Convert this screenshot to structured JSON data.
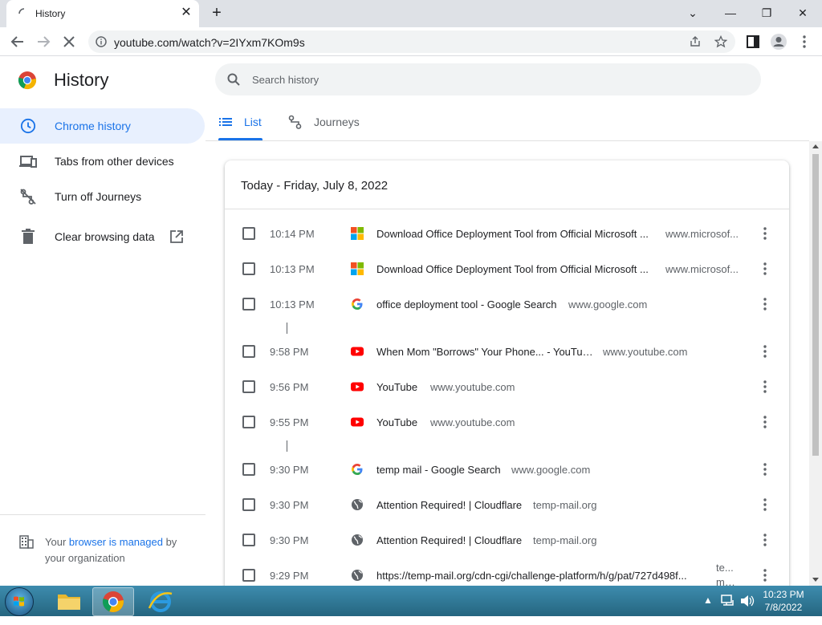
{
  "browser": {
    "tab_title": "History",
    "tab_close": "✕",
    "new_tab": "+",
    "url": "youtube.com/watch?v=2IYxm7KOm9s",
    "window_controls": [
      "⌄",
      "—",
      "❐",
      "✕"
    ]
  },
  "header": {
    "title": "History",
    "search_placeholder": "Search history"
  },
  "sidebar": {
    "items": [
      {
        "label": "Chrome history",
        "icon": "clock-icon",
        "active": true
      },
      {
        "label": "Tabs from other devices",
        "icon": "devices-icon",
        "active": false
      },
      {
        "label": "Turn off Journeys",
        "icon": "journeys-off-icon",
        "active": false
      },
      {
        "label": "Clear browsing data",
        "icon": "trash-icon",
        "active": false
      }
    ],
    "managed_prefix": "Your ",
    "managed_link": "browser is managed",
    "managed_suffix": " by your organization"
  },
  "tabs": [
    {
      "label": "List",
      "icon": "list-icon",
      "active": true
    },
    {
      "label": "Journeys",
      "icon": "journeys-icon",
      "active": false
    }
  ],
  "card": {
    "title": "Today - Friday, July 8, 2022"
  },
  "rows": [
    {
      "time": "10:14 PM",
      "favicon": "microsoft",
      "title": "Download Office Deployment Tool from Official Microsoft ...",
      "domain": "www.microsof..."
    },
    {
      "time": "10:13 PM",
      "favicon": "microsoft",
      "title": "Download Office Deployment Tool from Official Microsoft ...",
      "domain": "www.microsof..."
    },
    {
      "time": "10:13 PM",
      "favicon": "google",
      "title": "office deployment tool - Google Search",
      "domain": "www.google.com"
    },
    {
      "time": "9:58 PM",
      "favicon": "youtube",
      "title": "When Mom \"Borrows\" Your Phone... - YouTube",
      "domain": "www.youtube.com"
    },
    {
      "time": "9:56 PM",
      "favicon": "youtube",
      "title": "YouTube",
      "domain": "www.youtube.com"
    },
    {
      "time": "9:55 PM",
      "favicon": "youtube",
      "title": "YouTube",
      "domain": "www.youtube.com"
    },
    {
      "time": "9:30 PM",
      "favicon": "google",
      "title": "temp mail - Google Search",
      "domain": "www.google.com"
    },
    {
      "time": "9:30 PM",
      "favicon": "globe",
      "title": "Attention Required! | Cloudflare",
      "domain": "temp-mail.org"
    },
    {
      "time": "9:30 PM",
      "favicon": "globe",
      "title": "Attention Required! | Cloudflare",
      "domain": "temp-mail.org"
    },
    {
      "time": "9:29 PM",
      "favicon": "globe",
      "title": "https://temp-mail.org/cdn-cgi/challenge-platform/h/g/pat/727d498f...",
      "domain": "te... mai..."
    }
  ],
  "taskbar": {
    "time": "10:23 PM",
    "date": "7/8/2022"
  },
  "colors": {
    "accent": "#1a73e8",
    "active_bg": "#e8f0fe",
    "youtube": "#ff0000"
  }
}
